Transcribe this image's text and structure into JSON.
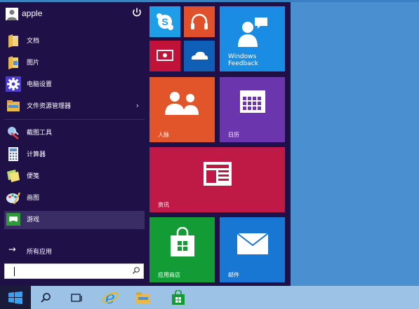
{
  "user": {
    "name": "apple"
  },
  "left_items": [
    {
      "label": "文档",
      "icon": "documents-folder-icon"
    },
    {
      "label": "图片",
      "icon": "pictures-folder-icon"
    },
    {
      "label": "电脑设置",
      "icon": "settings-gear-icon"
    },
    {
      "label": "文件资源管理器",
      "icon": "file-explorer-icon"
    },
    {
      "label": "截图工具",
      "icon": "snipping-tool-icon"
    },
    {
      "label": "计算器",
      "icon": "calculator-icon"
    },
    {
      "label": "便笺",
      "icon": "sticky-notes-icon"
    },
    {
      "label": "画图",
      "icon": "paint-icon"
    },
    {
      "label": "游戏",
      "icon": "games-controller-icon"
    }
  ],
  "all_apps_label": "所有应用",
  "search": {
    "value": "",
    "placeholder": ""
  },
  "tiles": {
    "windows_feedback": {
      "label_line1": "Windows",
      "label_line2": "Feedback"
    },
    "people": {
      "label": "人脉"
    },
    "calendar": {
      "label": "日历"
    },
    "news": {
      "label": "资讯"
    },
    "store": {
      "label": "应用商店"
    },
    "mail": {
      "label": "邮件"
    }
  },
  "colors": {
    "desktop": "#4a8fd0",
    "start_background": "#1f1148",
    "skype_tile": "#1d9ee6",
    "music_tile": "#e0502a",
    "video_tile": "#c1133a",
    "onedrive_tile": "#0e5fb5",
    "feedback_tile": "#1a8ce3",
    "people_tile": "#e2542a",
    "calendar_tile": "#6a35ad",
    "news_tile": "#bf1a45",
    "store_tile": "#139b35",
    "mail_tile": "#1777d2",
    "taskbar": "#9cc3e6"
  }
}
